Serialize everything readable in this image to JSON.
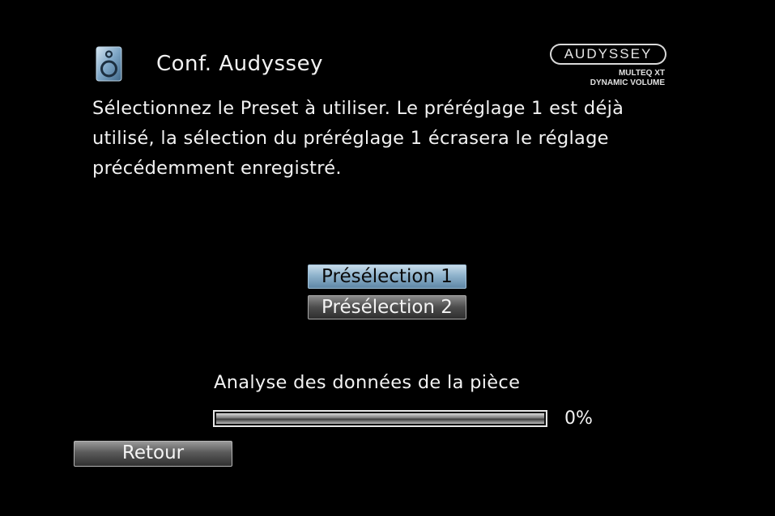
{
  "header": {
    "title": "Conf. Audyssey",
    "icon": "speaker-icon"
  },
  "brand": {
    "logo_text": "AUDYSSEY",
    "line1": "MULTEQ XT",
    "line2": "DYNAMIC VOLUME"
  },
  "instruction": "Sélectionnez le Preset à utiliser. Le préréglage 1 est déjà utilisé, la sélection du préréglage 1 écrasera le réglage précédemment enregistré.",
  "presets": [
    {
      "label": "Présélection 1",
      "selected": true
    },
    {
      "label": "Présélection 2",
      "selected": false
    }
  ],
  "progress": {
    "label": "Analyse des données de la pièce",
    "percent": 0,
    "value_text": "0%"
  },
  "back_label": "Retour",
  "colors": {
    "background": "#000000",
    "highlight": "#8fb3cc",
    "text": "#f2f2f2"
  }
}
